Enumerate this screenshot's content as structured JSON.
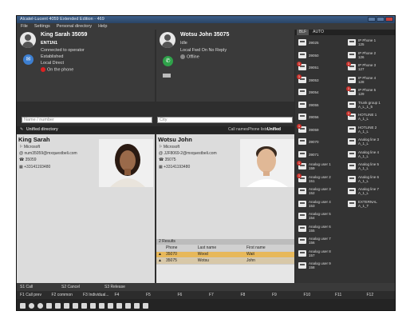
{
  "window": {
    "title": "Alcatel-Lucent 4059 Extended Edition - 469"
  },
  "menu": [
    "File",
    "Settings",
    "Personal directory",
    "Help"
  ],
  "call1": {
    "name": "King Sarah 35059",
    "line1": "ENT1N1",
    "line2": "Connected to operator",
    "line3": "Established",
    "line4": "Local Direct",
    "line5": "On the phone"
  },
  "call2": {
    "name": "Wotsu John 35075",
    "line1": "Idle",
    "line2": "Local Fwd On No Reply",
    "line3": "Offline"
  },
  "search": {
    "name_placeholder": "Name / number",
    "city_placeholder": "City"
  },
  "tabs": {
    "left": "Unified directory",
    "right1": "Call names",
    "right2": "Phone lists",
    "right3": "Unified directory"
  },
  "card1": {
    "name": "King Sarah",
    "company": "Microsoft",
    "email": "num35059@mxquestbeli.com",
    "ext": "35059",
    "phone": "+33141193480"
  },
  "card2": {
    "name": "Wotsu John",
    "company": "Microsoft",
    "email": "JJF8069-2@mxquestbeli.com",
    "ext": "35075",
    "phone": "+33141193480"
  },
  "results": {
    "count": "2 Results",
    "columns": [
      "Phone",
      "Last name",
      "First name"
    ],
    "rows": [
      {
        "phone": "35070",
        "last": "Wood",
        "first": "Wait"
      },
      {
        "phone": "35075",
        "last": "Wotsu",
        "first": "John"
      }
    ]
  },
  "panel": {
    "tabs": [
      "BLF",
      "AUTO"
    ],
    "col1": [
      {
        "label": "39025"
      },
      {
        "label": "39050"
      },
      {
        "label": "39051",
        "badge": "1"
      },
      {
        "label": "39053",
        "badge": "1"
      },
      {
        "label": "39054"
      },
      {
        "label": "39055"
      },
      {
        "label": "39056"
      },
      {
        "label": "39059",
        "badge": "1"
      },
      {
        "label": "39070"
      },
      {
        "label": "39071"
      },
      {
        "label": "Analog user 1\n159",
        "badge": "1"
      },
      {
        "label": "Analog user 2\n151",
        "badge": "1"
      },
      {
        "label": "Analog user 3\n152"
      },
      {
        "label": "Analog user 4\n153"
      },
      {
        "label": "Analog user 5\n154"
      },
      {
        "label": "Analog user 6\n155"
      },
      {
        "label": "Analog user 7\n156"
      },
      {
        "label": "Analog user 8\n157"
      },
      {
        "label": "Analog user 9\n158"
      }
    ],
    "col2": [
      {
        "label": "IP Phone 1\n125"
      },
      {
        "label": "IP Phone 2\n126"
      },
      {
        "label": "IP Phone 3\n127",
        "badge": "1"
      },
      {
        "label": "IP Phone 4\n128"
      },
      {
        "label": "IP Phone 5\n129",
        "badge": "1"
      },
      {
        "label": "Trunk group 1\nA_L_1_5"
      },
      {
        "label": "HOTLINE 1\nA_1_L",
        "badge": "1"
      },
      {
        "label": "HOTLINE 2\nA_1_L"
      },
      {
        "label": "Analog line 3\nA_1_L"
      },
      {
        "label": "Analog line 4\nA_1_L"
      },
      {
        "label": "Analog line 5\nA_1_L"
      },
      {
        "label": "Analog line 6\nA_1_L"
      },
      {
        "label": "Analog line 7\nA_1_L"
      },
      {
        "label": "EXTERNAL\nA_1_T"
      }
    ]
  },
  "status": {
    "s1": "S1 Call",
    "s2": "S2 Cancel",
    "s3": "S3 Release"
  },
  "fkeys": [
    "F1 Call prev",
    "F2 common",
    "F3 Individual...",
    "F4",
    "F5",
    "F6",
    "F7",
    "F8",
    "F9",
    "F10",
    "F11",
    "F12"
  ]
}
